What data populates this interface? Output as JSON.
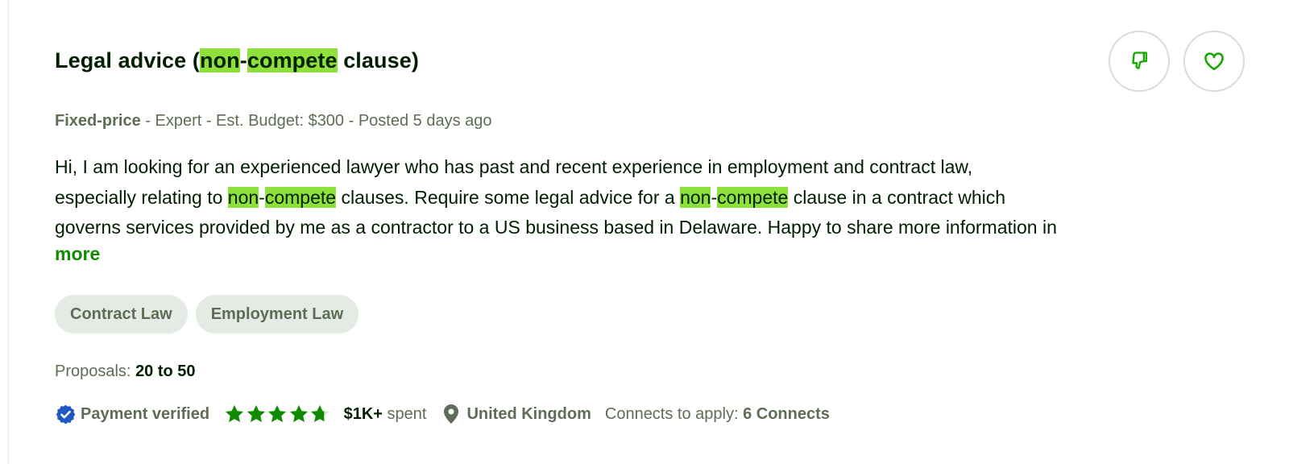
{
  "job": {
    "title_parts": [
      "Legal advice (",
      "non",
      "-",
      "compete",
      " clause)"
    ],
    "type": "Fixed-price",
    "meta_rest": " - Expert - Est. Budget: $300 - Posted 5 days ago",
    "description": {
      "line1": "Hi, I am looking for an experienced lawyer who has past and recent experience in employment and contract law,",
      "line2": [
        "especially relating to ",
        "non",
        "-",
        "compete",
        " clauses. Require some legal advice for a ",
        "non",
        "-",
        "compete",
        " clause in a contract which"
      ],
      "line3": "governs services provided by me as a contractor to a US business based in Delaware. Happy to share more information in"
    },
    "more_label": "more",
    "skills": [
      "Contract Law",
      "Employment Law"
    ],
    "proposals_label": "Proposals: ",
    "proposals_value": "20 to 50"
  },
  "client": {
    "payment_label": "Payment verified",
    "rating": 4.7,
    "stars_max": 5,
    "spent_amount": "$1K+",
    "spent_label": " spent",
    "location": "United Kingdom",
    "connects_label": "Connects to apply: ",
    "connects_value": "6 Connects"
  },
  "icons": {
    "dislike": "thumbs-down-icon",
    "save": "heart-icon",
    "verified": "verified-badge-icon",
    "star": "star-icon",
    "location": "map-pin-icon"
  },
  "colors": {
    "accent": "#108a00",
    "highlight": "#8ee03a",
    "verified_blue": "#1f57c3",
    "muted": "#5e6d55",
    "text": "#001e00"
  }
}
